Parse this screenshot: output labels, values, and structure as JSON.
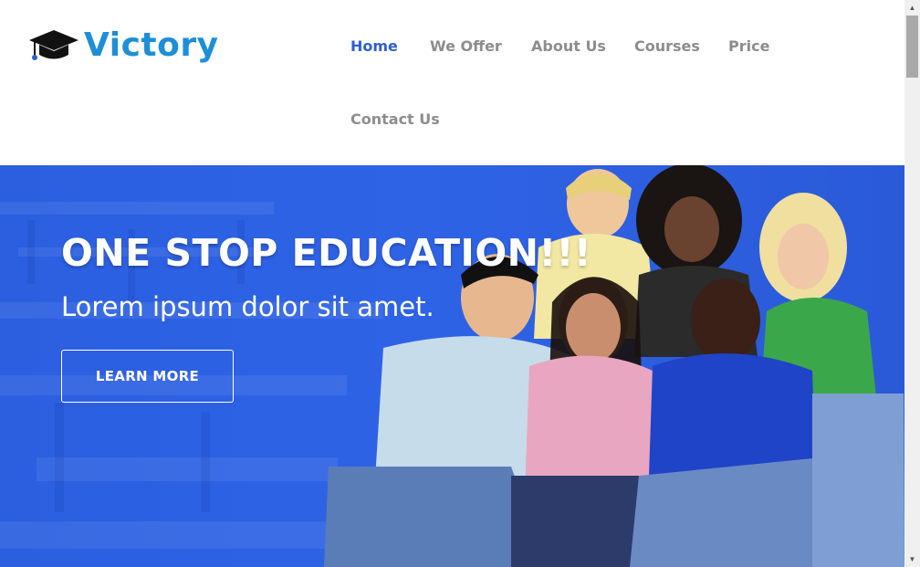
{
  "brand": {
    "name": "Victory",
    "logo_icon": "graduation-cap-icon",
    "color": "#1e8fd6"
  },
  "nav": {
    "items": [
      {
        "label": "Home",
        "active": true
      },
      {
        "label": "We Offer",
        "active": false
      },
      {
        "label": "About Us",
        "active": false
      },
      {
        "label": "Courses",
        "active": false
      },
      {
        "label": "Price",
        "active": false
      },
      {
        "label": "Contact Us",
        "active": false
      }
    ],
    "active_color": "#2f5fd0",
    "inactive_color": "#8d8d8d"
  },
  "hero": {
    "title": "ONE STOP EDUCATION!!!",
    "subtitle": "Lorem ipsum dolor sit amet.",
    "button_label": "LEARN MORE",
    "overlay_color": "#2f63e6"
  },
  "scrollbar": {
    "up_icon": "scroll-up-icon",
    "down_icon": "scroll-down-icon"
  }
}
